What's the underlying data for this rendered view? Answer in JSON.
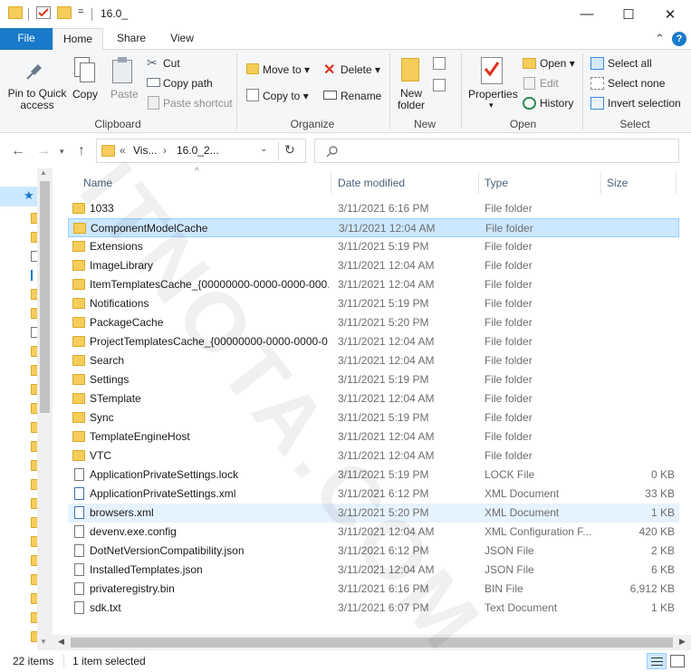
{
  "window": {
    "title": "16.0_",
    "quick_access_glyph": "=",
    "minimize_glyph": "—",
    "maximize_glyph": "☐",
    "close_glyph": "✕"
  },
  "tabs": {
    "file": "File",
    "home": "Home",
    "share": "Share",
    "view": "View"
  },
  "ribbon": {
    "clipboard": {
      "label": "Clipboard",
      "pin": "Pin to Quick access",
      "copy": "Copy",
      "paste": "Paste",
      "cut": "Cut",
      "copy_path": "Copy path",
      "paste_shortcut": "Paste shortcut"
    },
    "organize": {
      "label": "Organize",
      "move_to": "Move to",
      "copy_to": "Copy to",
      "delete": "Delete",
      "rename": "Rename"
    },
    "new": {
      "label": "New",
      "new_folder": "New folder"
    },
    "open": {
      "label": "Open",
      "properties": "Properties",
      "open": "Open",
      "edit": "Edit",
      "history": "History"
    },
    "select": {
      "label": "Select",
      "select_all": "Select all",
      "select_none": "Select none",
      "invert": "Invert selection"
    }
  },
  "address": {
    "chevrons": "«",
    "crumb1": "Vis...",
    "crumb2": "16.0_2...",
    "search_placeholder": ""
  },
  "columns": {
    "name": "Name",
    "date": "Date modified",
    "type": "Type",
    "size": "Size"
  },
  "files": [
    {
      "name": "1033",
      "date": "3/11/2021 6:16 PM",
      "type": "File folder",
      "size": "",
      "icon": "folder"
    },
    {
      "name": "ComponentModelCache",
      "date": "3/11/2021 12:04 AM",
      "type": "File folder",
      "size": "",
      "icon": "folder"
    },
    {
      "name": "Extensions",
      "date": "3/11/2021 5:19 PM",
      "type": "File folder",
      "size": "",
      "icon": "folder"
    },
    {
      "name": "ImageLibrary",
      "date": "3/11/2021 12:04 AM",
      "type": "File folder",
      "size": "",
      "icon": "folder"
    },
    {
      "name": "ItemTemplatesCache_{00000000-0000-0000-000...",
      "date": "3/11/2021 12:04 AM",
      "type": "File folder",
      "size": "",
      "icon": "folder"
    },
    {
      "name": "Notifications",
      "date": "3/11/2021 5:19 PM",
      "type": "File folder",
      "size": "",
      "icon": "folder"
    },
    {
      "name": "PackageCache",
      "date": "3/11/2021 5:20 PM",
      "type": "File folder",
      "size": "",
      "icon": "folder"
    },
    {
      "name": "ProjectTemplatesCache_{00000000-0000-0000-0...",
      "date": "3/11/2021 12:04 AM",
      "type": "File folder",
      "size": "",
      "icon": "folder"
    },
    {
      "name": "Search",
      "date": "3/11/2021 12:04 AM",
      "type": "File folder",
      "size": "",
      "icon": "folder"
    },
    {
      "name": "Settings",
      "date": "3/11/2021 5:19 PM",
      "type": "File folder",
      "size": "",
      "icon": "folder"
    },
    {
      "name": "STemplate",
      "date": "3/11/2021 12:04 AM",
      "type": "File folder",
      "size": "",
      "icon": "folder"
    },
    {
      "name": "Sync",
      "date": "3/11/2021 5:19 PM",
      "type": "File folder",
      "size": "",
      "icon": "folder"
    },
    {
      "name": "TemplateEngineHost",
      "date": "3/11/2021 12:04 AM",
      "type": "File folder",
      "size": "",
      "icon": "folder"
    },
    {
      "name": "VTC",
      "date": "3/11/2021 12:04 AM",
      "type": "File folder",
      "size": "",
      "icon": "folder"
    },
    {
      "name": "ApplicationPrivateSettings.lock",
      "date": "3/11/2021 5:19 PM",
      "type": "LOCK File",
      "size": "0 KB",
      "icon": "file"
    },
    {
      "name": "ApplicationPrivateSettings.xml",
      "date": "3/11/2021 6:12 PM",
      "type": "XML Document",
      "size": "33 KB",
      "icon": "xml"
    },
    {
      "name": "browsers.xml",
      "date": "3/11/2021 5:20 PM",
      "type": "XML Document",
      "size": "1 KB",
      "icon": "xml"
    },
    {
      "name": "devenv.exe.config",
      "date": "3/11/2021 12:04 AM",
      "type": "XML Configuration F...",
      "size": "420 KB",
      "icon": "config"
    },
    {
      "name": "DotNetVersionCompatibility.json",
      "date": "3/11/2021 6:12 PM",
      "type": "JSON File",
      "size": "2 KB",
      "icon": "json"
    },
    {
      "name": "InstalledTemplates.json",
      "date": "3/11/2021 12:04 AM",
      "type": "JSON File",
      "size": "6 KB",
      "icon": "json"
    },
    {
      "name": "privateregistry.bin",
      "date": "3/11/2021 6:16 PM",
      "type": "BIN File",
      "size": "6,912 KB",
      "icon": "file"
    },
    {
      "name": "sdk.txt",
      "date": "3/11/2021 6:07 PM",
      "type": "Text Document",
      "size": "1 KB",
      "icon": "txt"
    }
  ],
  "selected_index": 1,
  "hover_index": 16,
  "status": {
    "count": "22 items",
    "selected": "1 item selected"
  },
  "watermark": "ITNOTA.COM",
  "colors": {
    "accent": "#1979ca",
    "folder": "#f6cd5a",
    "selection": "#cce8ff",
    "hover": "#e5f3ff"
  }
}
